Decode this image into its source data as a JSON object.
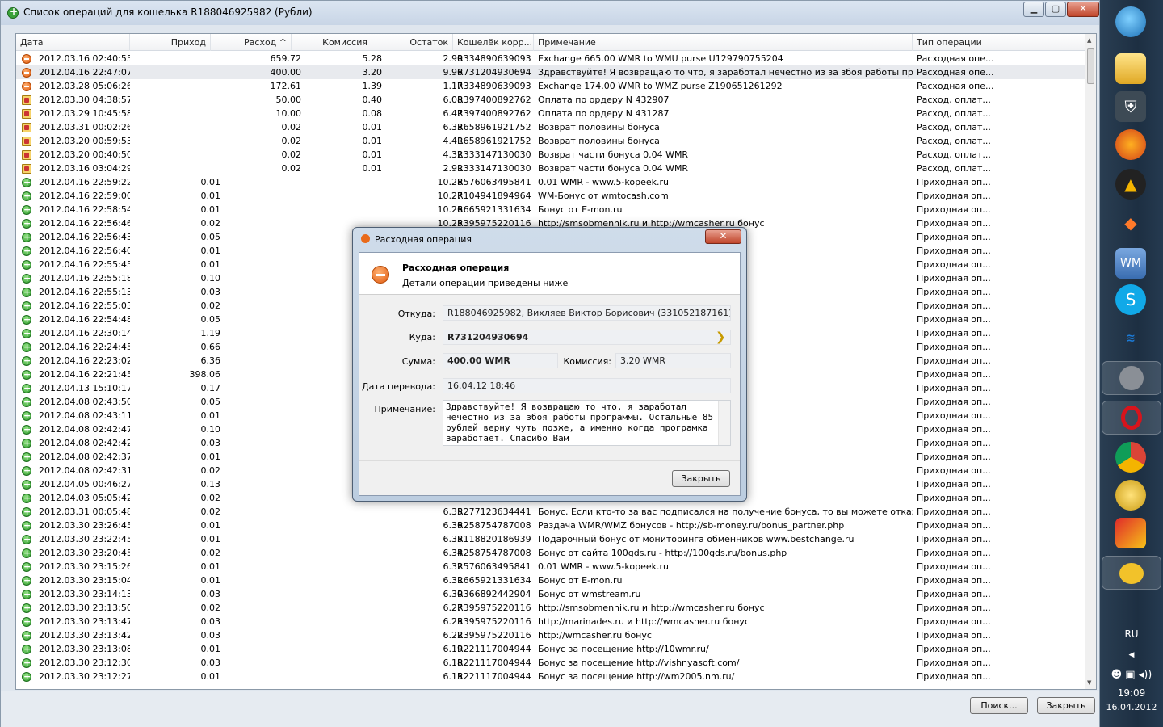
{
  "window": {
    "title": "Список операций для кошелька R188046925982 (Рубли)",
    "minimize": "▁",
    "maximize": "▢",
    "close": "✕"
  },
  "columns": [
    "Дата",
    "Приход",
    "Расход ^",
    "Комиссия",
    "Остаток",
    "Кошелёк корр...",
    "Примечание",
    "Тип операции"
  ],
  "rows": [
    {
      "icon": "out",
      "date": "2012.03.16 02:40:55",
      "in": "",
      "out": "659.72",
      "fee": "5.28",
      "bal": "2.90",
      "purse": "R334890639093",
      "note": "Exchange 665.00 WMR to WMU purse U129790755204",
      "type": "Расходная опе..."
    },
    {
      "icon": "out",
      "date": "2012.04.16 22:47:07",
      "in": "",
      "out": "400.00",
      "fee": "3.20",
      "bal": "9.96",
      "purse": "R731204930694",
      "note": "Здравствуйте! Я возвращаю то что, я заработал нечестно из за збоя работы програм...",
      "type": "Расходная опе...",
      "sel": true
    },
    {
      "icon": "out",
      "date": "2012.03.28 05:06:26",
      "in": "",
      "out": "172.61",
      "fee": "1.39",
      "bal": "1.17",
      "purse": "R334890639093",
      "note": "Exchange 174.00 WMR to WMZ purse Z190651261292",
      "type": "Расходная опе..."
    },
    {
      "icon": "pay",
      "date": "2012.03.30 04:38:57",
      "in": "",
      "out": "50.00",
      "fee": "0.40",
      "bal": "6.08",
      "purse": "R397400892762",
      "note": "Оплата по ордеру N 432907",
      "type": "Расход, оплат..."
    },
    {
      "icon": "pay",
      "date": "2012.03.29 10:45:58",
      "in": "",
      "out": "10.00",
      "fee": "0.08",
      "bal": "6.47",
      "purse": "R397400892762",
      "note": "Оплата по ордеру N 431287",
      "type": "Расход, оплат..."
    },
    {
      "icon": "pay",
      "date": "2012.03.31 00:02:26",
      "in": "",
      "out": "0.02",
      "fee": "0.01",
      "bal": "6.33",
      "purse": "R658961921752",
      "note": "Возврат половины бонуса",
      "type": "Расход, оплат..."
    },
    {
      "icon": "pay",
      "date": "2012.03.20 00:59:53",
      "in": "",
      "out": "0.02",
      "fee": "0.01",
      "bal": "4.41",
      "purse": "R658961921752",
      "note": "Возврат половины бонуса",
      "type": "Расход, оплат..."
    },
    {
      "icon": "pay",
      "date": "2012.03.20 00:40:50",
      "in": "",
      "out": "0.02",
      "fee": "0.01",
      "bal": "4.32",
      "purse": "R333147130030",
      "note": "Возврат части бонуса 0.04 WMR",
      "type": "Расход, оплат..."
    },
    {
      "icon": "pay",
      "date": "2012.03.16 03:04:29",
      "in": "",
      "out": "0.02",
      "fee": "0.01",
      "bal": "2.91",
      "purse": "R333147130030",
      "note": "Возврат части бонуса 0.04 WMR",
      "type": "Расход, оплат..."
    },
    {
      "icon": "in",
      "date": "2012.04.16 22:59:22",
      "in": "0.01",
      "out": "",
      "fee": "",
      "bal": "10.28",
      "purse": "R576063495841",
      "note": "0.01 WMR - www.5-kopeek.ru",
      "type": "Приходная оп..."
    },
    {
      "icon": "in",
      "date": "2012.04.16 22:59:00",
      "in": "0.01",
      "out": "",
      "fee": "",
      "bal": "10.27",
      "purse": "R104941894964",
      "note": "WM-Бонус от wmtocash.com",
      "type": "Приходная оп..."
    },
    {
      "icon": "in",
      "date": "2012.04.16 22:58:54",
      "in": "0.01",
      "out": "",
      "fee": "",
      "bal": "10.26",
      "purse": "R665921331634",
      "note": "Бонус от E-mon.ru",
      "type": "Приходная оп..."
    },
    {
      "icon": "in",
      "date": "2012.04.16 22:56:46",
      "in": "0.02",
      "out": "",
      "fee": "",
      "bal": "10.25",
      "purse": "R395975220116",
      "note": "http://smsobmennik.ru и http://wmcasher.ru бонус",
      "type": "Приходная оп..."
    },
    {
      "icon": "in",
      "date": "2012.04.16 22:56:43",
      "in": "0.05",
      "out": "",
      "fee": "",
      "bal": "",
      "purse": "",
      "note": "",
      "type": "Приходная оп..."
    },
    {
      "icon": "in",
      "date": "2012.04.16 22:56:40",
      "in": "0.01",
      "out": "",
      "fee": "",
      "bal": "",
      "purse": "",
      "note": "",
      "type": "Приходная оп..."
    },
    {
      "icon": "in",
      "date": "2012.04.16 22:55:45",
      "in": "0.01",
      "out": "",
      "fee": "",
      "bal": "",
      "purse": "",
      "note": "",
      "type": "Приходная оп..."
    },
    {
      "icon": "in",
      "date": "2012.04.16 22:55:18",
      "in": "0.10",
      "out": "",
      "fee": "",
      "bal": "",
      "purse": "",
      "note": "",
      "type": "Приходная оп..."
    },
    {
      "icon": "in",
      "date": "2012.04.16 22:55:13",
      "in": "0.03",
      "out": "",
      "fee": "",
      "bal": "",
      "purse": "",
      "note": "",
      "type": "Приходная оп..."
    },
    {
      "icon": "in",
      "date": "2012.04.16 22:55:03",
      "in": "0.02",
      "out": "",
      "fee": "",
      "bal": "",
      "purse": "",
      "note": "",
      "type": "Приходная оп..."
    },
    {
      "icon": "in",
      "date": "2012.04.16 22:54:48",
      "in": "0.05",
      "out": "",
      "fee": "",
      "bal": "",
      "purse": "",
      "note": "",
      "type": "Приходная оп..."
    },
    {
      "icon": "in",
      "date": "2012.04.16 22:30:14",
      "in": "1.19",
      "out": "",
      "fee": "",
      "bal": "",
      "purse": "",
      "note": "er bid 33319770",
      "type": "Приходная оп..."
    },
    {
      "icon": "in",
      "date": "2012.04.16 22:24:45",
      "in": "0.66",
      "out": "",
      "fee": "",
      "bal": "",
      "purse": "",
      "note": "er bid 33319670",
      "type": "Приходная оп..."
    },
    {
      "icon": "in",
      "date": "2012.04.16 22:23:02",
      "in": "6.36",
      "out": "",
      "fee": "",
      "bal": "",
      "purse": "",
      "note": "er bid 33319548",
      "type": "Приходная оп..."
    },
    {
      "icon": "in",
      "date": "2012.04.16 22:21:45",
      "in": "398.06",
      "out": "",
      "fee": "",
      "bal": "",
      "purse": "",
      "note": "er bid 33319505",
      "type": "Приходная оп..."
    },
    {
      "icon": "in",
      "date": "2012.04.13 15:10:17",
      "in": "0.17",
      "out": "",
      "fee": "",
      "bal": "",
      "purse": "",
      "note": "noney.me/",
      "type": "Приходная оп..."
    },
    {
      "icon": "in",
      "date": "2012.04.08 02:43:50",
      "in": "0.05",
      "out": "",
      "fee": "",
      "bal": "",
      "purse": "",
      "note": "",
      "type": "Приходная оп..."
    },
    {
      "icon": "in",
      "date": "2012.04.08 02:43:11",
      "in": "0.01",
      "out": "",
      "fee": "",
      "bal": "",
      "purse": "",
      "note": "",
      "type": "Приходная оп..."
    },
    {
      "icon": "in",
      "date": "2012.04.08 02:42:47",
      "in": "0.10",
      "out": "",
      "fee": "",
      "bal": "",
      "purse": "",
      "note": "",
      "type": "Приходная оп..."
    },
    {
      "icon": "in",
      "date": "2012.04.08 02:42:42",
      "in": "0.03",
      "out": "",
      "fee": "",
      "bal": "",
      "purse": "",
      "note": "",
      "type": "Приходная оп..."
    },
    {
      "icon": "in",
      "date": "2012.04.08 02:42:37",
      "in": "0.01",
      "out": "",
      "fee": "",
      "bal": "",
      "purse": "",
      "note": "",
      "type": "Приходная оп..."
    },
    {
      "icon": "in",
      "date": "2012.04.08 02:42:31",
      "in": "0.02",
      "out": "",
      "fee": "",
      "bal": "",
      "purse": "",
      "note": "",
      "type": "Приходная оп..."
    },
    {
      "icon": "in",
      "date": "2012.04.05 00:46:27",
      "in": "0.13",
      "out": "",
      "fee": "",
      "bal": "",
      "purse": "",
      "note": "noney.me/",
      "type": "Приходная оп..."
    },
    {
      "icon": "in",
      "date": "2012.04.03 05:05:42",
      "in": "0.02",
      "out": "",
      "fee": "",
      "bal": "",
      "purse": "",
      "note": "",
      "type": "Приходная оп..."
    },
    {
      "icon": "in",
      "date": "2012.03.31 00:05:48",
      "in": "0.02",
      "out": "",
      "fee": "",
      "bal": "6.35",
      "purse": "R277123634441",
      "note": "Бонус. Если кто-то за вас подписался на получение бонуса, то вы можете отказаться ...",
      "type": "Приходная оп..."
    },
    {
      "icon": "in",
      "date": "2012.03.30 23:26:45",
      "in": "0.01",
      "out": "",
      "fee": "",
      "bal": "6.36",
      "purse": "R258754787008",
      "note": "Раздача WMR/WMZ бонусов - http://sb-money.ru/bonus_partner.php",
      "type": "Приходная оп..."
    },
    {
      "icon": "in",
      "date": "2012.03.30 23:22:45",
      "in": "0.01",
      "out": "",
      "fee": "",
      "bal": "6.35",
      "purse": "R118820186939",
      "note": "Подарочный бонус от мониторинга обменников www.bestchange.ru",
      "type": "Приходная оп..."
    },
    {
      "icon": "in",
      "date": "2012.03.30 23:20:45",
      "in": "0.02",
      "out": "",
      "fee": "",
      "bal": "6.34",
      "purse": "R258754787008",
      "note": "Бонус от сайта 100gds.ru - http://100gds.ru/bonus.php",
      "type": "Приходная оп..."
    },
    {
      "icon": "in",
      "date": "2012.03.30 23:15:26",
      "in": "0.01",
      "out": "",
      "fee": "",
      "bal": "6.32",
      "purse": "R576063495841",
      "note": "0.01 WMR - www.5-kopeek.ru",
      "type": "Приходная оп..."
    },
    {
      "icon": "in",
      "date": "2012.03.30 23:15:04",
      "in": "0.01",
      "out": "",
      "fee": "",
      "bal": "6.31",
      "purse": "R665921331634",
      "note": "Бонус от E-mon.ru",
      "type": "Приходная оп..."
    },
    {
      "icon": "in",
      "date": "2012.03.30 23:14:13",
      "in": "0.03",
      "out": "",
      "fee": "",
      "bal": "6.30",
      "purse": "R366892442904",
      "note": "Бонус от wmstream.ru",
      "type": "Приходная оп..."
    },
    {
      "icon": "in",
      "date": "2012.03.30 23:13:50",
      "in": "0.02",
      "out": "",
      "fee": "",
      "bal": "6.27",
      "purse": "R395975220116",
      "note": "http://smsobmennik.ru и http://wmcasher.ru бонус",
      "type": "Приходная оп..."
    },
    {
      "icon": "in",
      "date": "2012.03.30 23:13:47",
      "in": "0.03",
      "out": "",
      "fee": "",
      "bal": "6.25",
      "purse": "R395975220116",
      "note": "http://marinades.ru и http://wmcasher.ru бонус",
      "type": "Приходная оп..."
    },
    {
      "icon": "in",
      "date": "2012.03.30 23:13:42",
      "in": "0.03",
      "out": "",
      "fee": "",
      "bal": "6.22",
      "purse": "R395975220116",
      "note": "http://wmcasher.ru бонус",
      "type": "Приходная оп..."
    },
    {
      "icon": "in",
      "date": "2012.03.30 23:13:08",
      "in": "0.01",
      "out": "",
      "fee": "",
      "bal": "6.19",
      "purse": "R221117004944",
      "note": "Бонус за посещение http://10wmr.ru/",
      "type": "Приходная оп..."
    },
    {
      "icon": "in",
      "date": "2012.03.30 23:12:30",
      "in": "0.03",
      "out": "",
      "fee": "",
      "bal": "6.18",
      "purse": "R221117004944",
      "note": "Бонус за посещение http://vishnyasoft.com/",
      "type": "Приходная оп..."
    },
    {
      "icon": "in",
      "date": "2012.03.30 23:12:27",
      "in": "0.01",
      "out": "",
      "fee": "",
      "bal": "6.15",
      "purse": "R221117004944",
      "note": "Бонус за посещение http://wm2005.nm.ru/",
      "type": "Приходная оп..."
    }
  ],
  "footer": {
    "search": "Поиск...",
    "close": "Закрыть"
  },
  "dialog": {
    "title": "Расходная операция",
    "heading": "Расходная операция",
    "subheading": "Детали операции приведены ниже",
    "from_label": "Откуда:",
    "from_value": "R188046925982, Вихляев Виктор Борисович (331052187161)",
    "to_label": "Куда:",
    "to_value": "R731204930694",
    "sum_label": "Сумма:",
    "sum_value": "400.00 WMR",
    "fee_label": "Комиссия:",
    "fee_value": "3.20 WMR",
    "date_label": "Дата перевода:",
    "date_value": "16.04.12 18:46",
    "note_label": "Примечание:",
    "note_value": "Здравствуйте! Я возвращаю то что, я заработал нечестно из за збоя работы программы. Остальные 85 рублей верну чуть позже, а именно когда програмка заработает. Спасибо Вам",
    "close": "Закрыть",
    "x": "✕"
  },
  "taskbar": {
    "lang": "RU",
    "time": "19:09",
    "date": "16.04.2012",
    "icons": [
      "windows-start-icon",
      "folder-icon",
      "tank-icon",
      "firefox-icon",
      "aimp-icon",
      "fish-icon",
      "webmoney-icon",
      "skype-icon",
      "surf-icon",
      "gear-app-icon",
      "opera-icon",
      "chrome-icon",
      "coin-icon",
      "tools-icon",
      "webmoney-keeper-icon"
    ]
  }
}
